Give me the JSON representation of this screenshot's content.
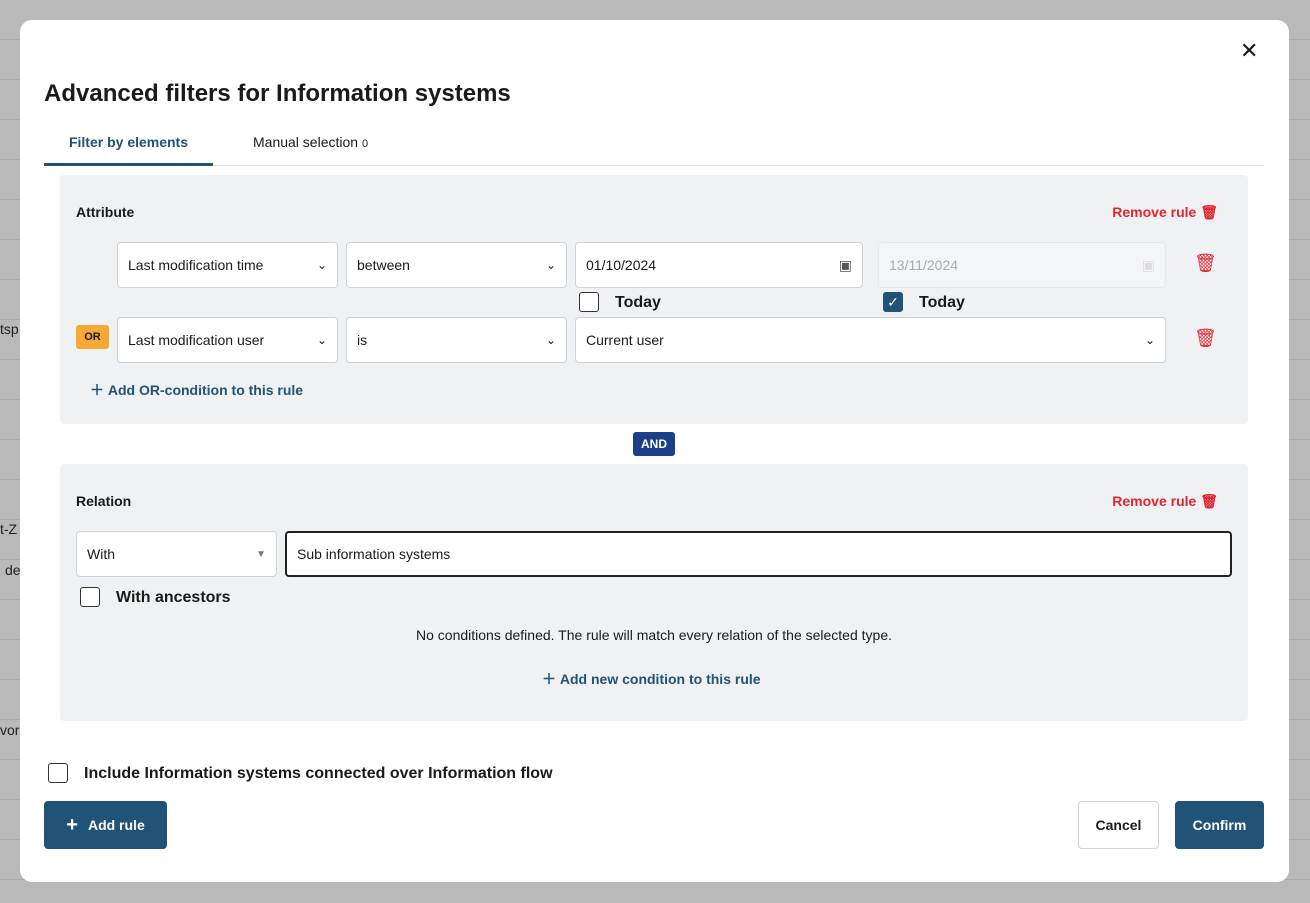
{
  "background": {
    "fragments": [
      "tsp",
      "t-Z",
      "de",
      "vor"
    ]
  },
  "modal": {
    "title": "Advanced filters for Information systems",
    "close_icon": "close-icon"
  },
  "tabs": [
    {
      "label": "Filter by elements",
      "active": true
    },
    {
      "label": "Manual selection",
      "count": "0"
    }
  ],
  "attribute_rule": {
    "label": "Attribute",
    "remove_label": "Remove rule",
    "row1": {
      "attribute": "Last modification time",
      "operator": "between",
      "from": "01/10/2024",
      "to": "13/11/2024",
      "from_today_label": "Today",
      "from_today": false,
      "to_today_label": "Today",
      "to_today": true
    },
    "row2": {
      "connector": "OR",
      "attribute": "Last modification user",
      "operator": "is",
      "value": "Current user"
    },
    "add_or_label": "Add OR-condition to this rule"
  },
  "and_label": "AND",
  "relation_rule": {
    "label": "Relation",
    "remove_label": "Remove rule",
    "direction": "With",
    "relation": "Sub information systems",
    "ancestors_label": "With ancestors",
    "ancestors": false,
    "empty_text": "No conditions defined. The rule will match every relation of the selected type.",
    "add_condition_label": "Add new condition to this rule"
  },
  "include_label": "Include Information systems connected over Information flow",
  "include": false,
  "footer": {
    "add_rule": "Add rule",
    "cancel": "Cancel",
    "confirm": "Confirm"
  },
  "colors": {
    "primary": "#215377",
    "danger": "#e0252f",
    "or_badge": "#f7a936",
    "and_badge": "#1d3f8a"
  }
}
